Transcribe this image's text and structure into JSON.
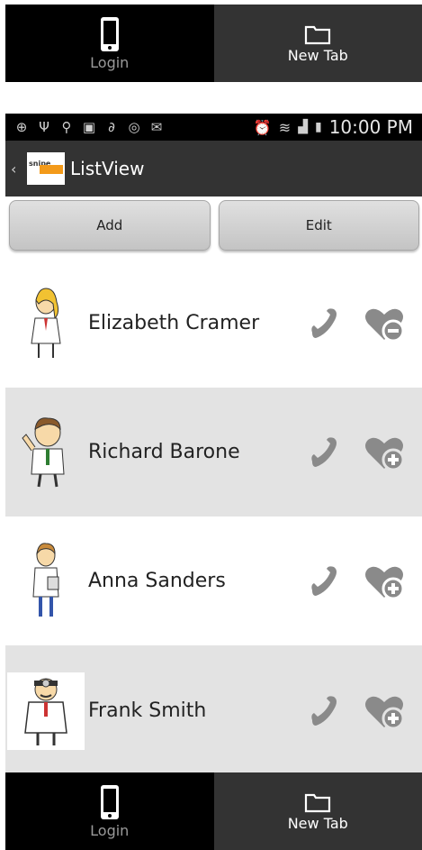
{
  "top_tabs": {
    "login_label": "Login",
    "new_tab_label": "New Tab"
  },
  "status_bar": {
    "time": "10:00 PM"
  },
  "action_bar": {
    "logo_text": "snipe",
    "title": "ListView"
  },
  "buttons": {
    "add_label": "Add",
    "edit_label": "Edit"
  },
  "contacts": [
    {
      "name": "Elizabeth Cramer",
      "favorite_action": "remove"
    },
    {
      "name": "Richard Barone",
      "favorite_action": "add"
    },
    {
      "name": "Anna Sanders",
      "favorite_action": "add"
    },
    {
      "name": "Frank Smith",
      "favorite_action": "add"
    }
  ],
  "bottom_tabs": {
    "login_label": "Login",
    "new_tab_label": "New Tab"
  },
  "colors": {
    "tab_dark": "#000000",
    "tab_gray": "#333333",
    "row_alt": "#e3e3e3",
    "icon_gray": "#8a8a8a"
  }
}
